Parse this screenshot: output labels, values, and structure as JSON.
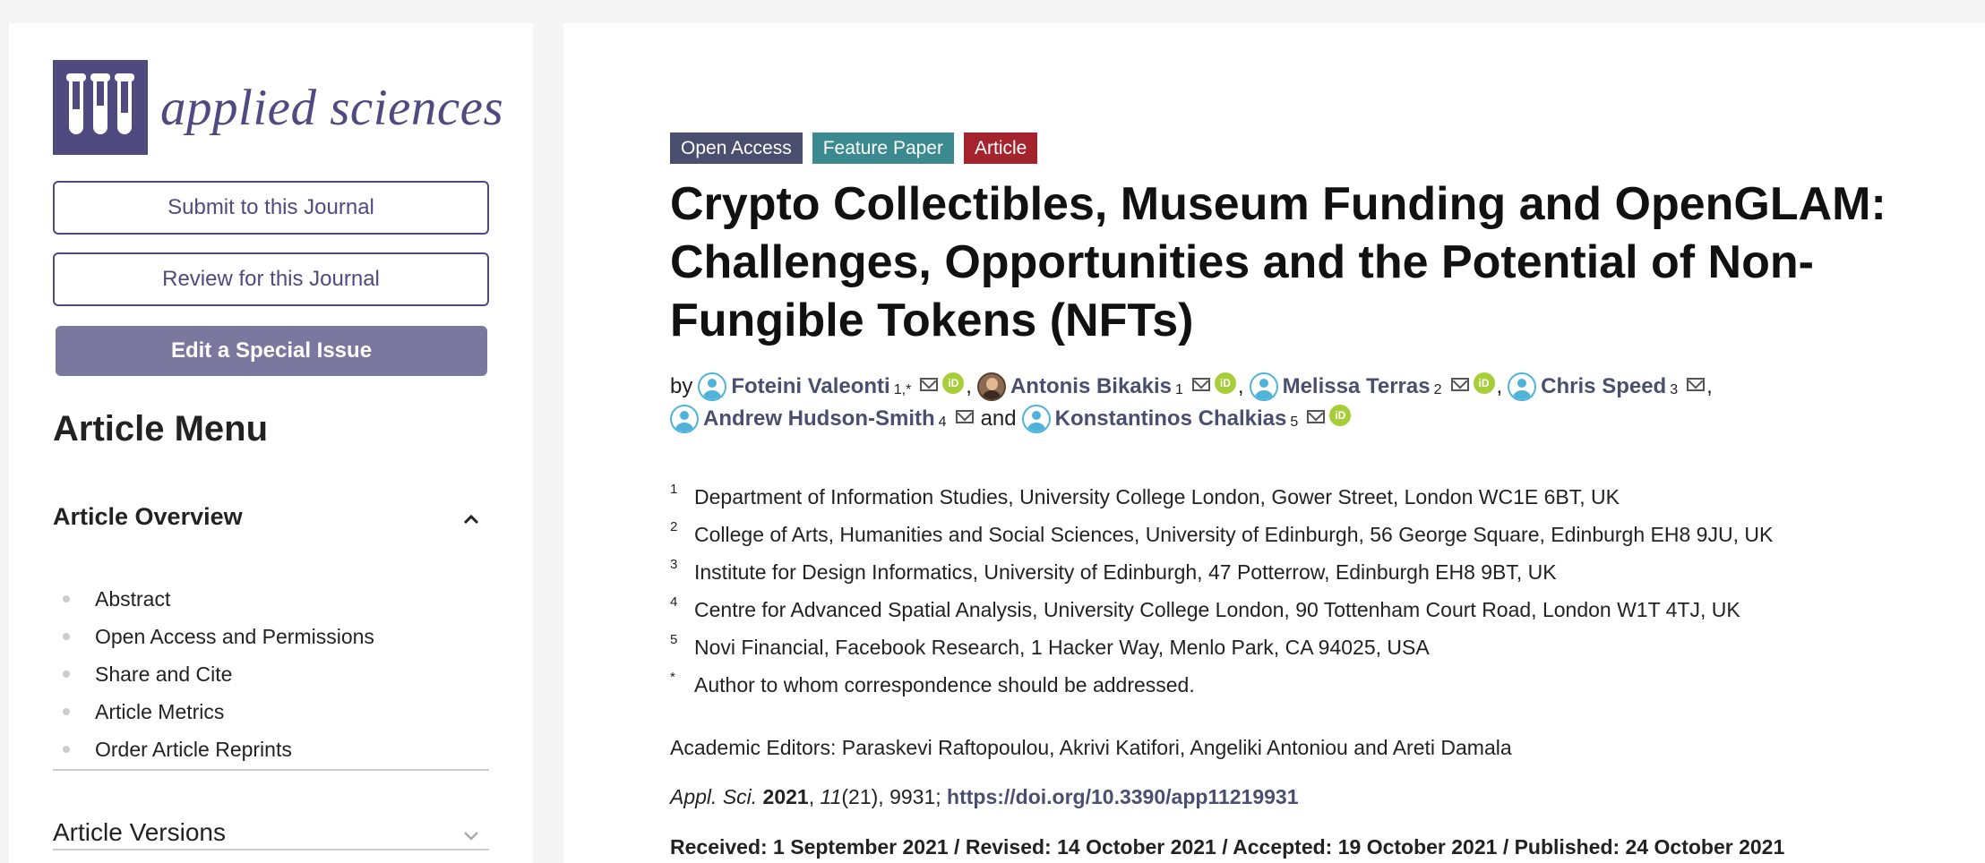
{
  "sidebar": {
    "logo_text": "applied sciences",
    "submit_label": "Submit to this Journal",
    "review_label": "Review for this Journal",
    "edit_label": "Edit a Special Issue",
    "menu_title": "Article Menu",
    "overview_label": "Article Overview",
    "items": [
      "Abstract",
      "Open Access and Permissions",
      "Share and Cite",
      "Article Metrics",
      "Order Article Reprints"
    ],
    "versions_label": "Article Versions"
  },
  "article": {
    "badges": [
      "Open Access",
      "Feature Paper",
      "Article"
    ],
    "title": "Crypto Collectibles, Museum Funding and OpenGLAM: Challenges, Opportunities and the Potential of Non-Fungible Tokens (NFTs)",
    "by": "by",
    "and": "and",
    "authors": [
      {
        "name": "Foteini Valeonti",
        "sup": "1,*"
      },
      {
        "name": "Antonis Bikakis",
        "sup": "1"
      },
      {
        "name": "Melissa Terras",
        "sup": "2"
      },
      {
        "name": "Chris Speed",
        "sup": "3"
      },
      {
        "name": "Andrew Hudson-Smith",
        "sup": "4"
      },
      {
        "name": "Konstantinos Chalkias",
        "sup": "5"
      }
    ],
    "affiliations": [
      {
        "num": "1",
        "text": "Department of Information Studies, University College London, Gower Street, London WC1E 6BT, UK"
      },
      {
        "num": "2",
        "text": "College of Arts, Humanities and Social Sciences, University of Edinburgh, 56 George Square, Edinburgh EH8 9JU, UK"
      },
      {
        "num": "3",
        "text": "Institute for Design Informatics, University of Edinburgh, 47 Potterrow, Edinburgh EH8 9BT, UK"
      },
      {
        "num": "4",
        "text": "Centre for Advanced Spatial Analysis, University College London, 90 Tottenham Court Road, London W1T 4TJ, UK"
      },
      {
        "num": "5",
        "text": "Novi Financial, Facebook Research, 1 Hacker Way, Menlo Park, CA 94025, USA"
      },
      {
        "num": "*",
        "text": "Author to whom correspondence should be addressed."
      }
    ],
    "editors": "Academic Editors: Paraskevi Raftopoulou, Akrivi Katifori, Angeliki Antoniou and Areti Damala",
    "citation": {
      "journal": "Appl. Sci.",
      "year": "2021",
      "volume": "11",
      "issue_pages": "(21), 9931; ",
      "doi": "https://doi.org/10.3390/app11219931"
    },
    "dates": "Received: 1 September 2021 / Revised: 14 October 2021 / Accepted: 19 October 2021 / Published: 24 October 2021"
  },
  "colors": {
    "brand": "#4f4a7f",
    "link": "#4a4f70",
    "open_access": "#4a4f70",
    "feature_paper": "#3a8a8f",
    "article": "#a4232c",
    "orcid": "#a6ce39"
  }
}
